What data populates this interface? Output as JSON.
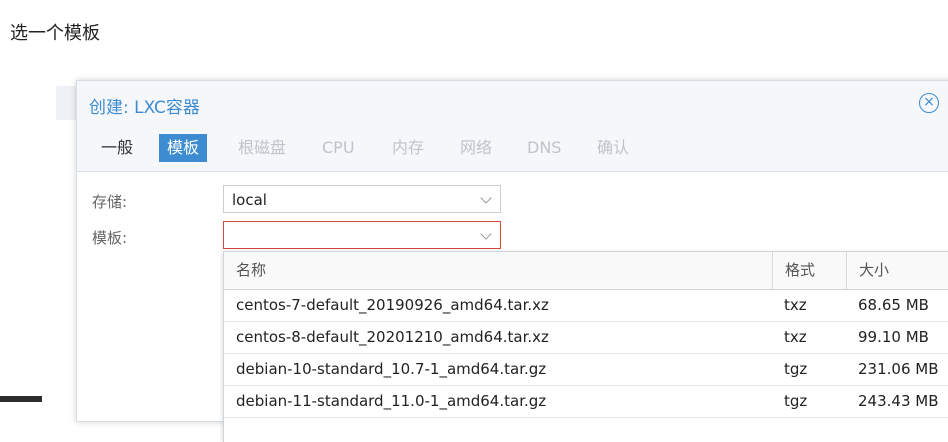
{
  "caption": "选一个模板",
  "dialog": {
    "title": "创建: LXC容器",
    "close_icon": "close-circle-icon",
    "tabs": [
      {
        "label": "一般",
        "state": "enabled"
      },
      {
        "label": "模板",
        "state": "active"
      },
      {
        "label": "根磁盘",
        "state": "disabled"
      },
      {
        "label": "CPU",
        "state": "disabled"
      },
      {
        "label": "内存",
        "state": "disabled"
      },
      {
        "label": "网络",
        "state": "disabled"
      },
      {
        "label": "DNS",
        "state": "disabled"
      },
      {
        "label": "确认",
        "state": "disabled"
      }
    ],
    "form": {
      "storage_label": "存储:",
      "storage_value": "local",
      "template_label": "模板:",
      "template_value": ""
    },
    "template_list": {
      "columns": [
        "名称",
        "格式",
        "大小"
      ],
      "rows": [
        {
          "name": "centos-7-default_20190926_amd64.tar.xz",
          "format": "txz",
          "size": "68.65 MB"
        },
        {
          "name": "centos-8-default_20201210_amd64.tar.xz",
          "format": "txz",
          "size": "99.10 MB"
        },
        {
          "name": "debian-10-standard_10.7-1_amd64.tar.gz",
          "format": "tgz",
          "size": "231.06 MB"
        },
        {
          "name": "debian-11-standard_11.0-1_amd64.tar.gz",
          "format": "tgz",
          "size": "243.43 MB"
        }
      ]
    }
  },
  "colors": {
    "accent": "#3d8cd1",
    "error_border": "#cf4b3c",
    "disabled_text": "#bfc4ca"
  }
}
